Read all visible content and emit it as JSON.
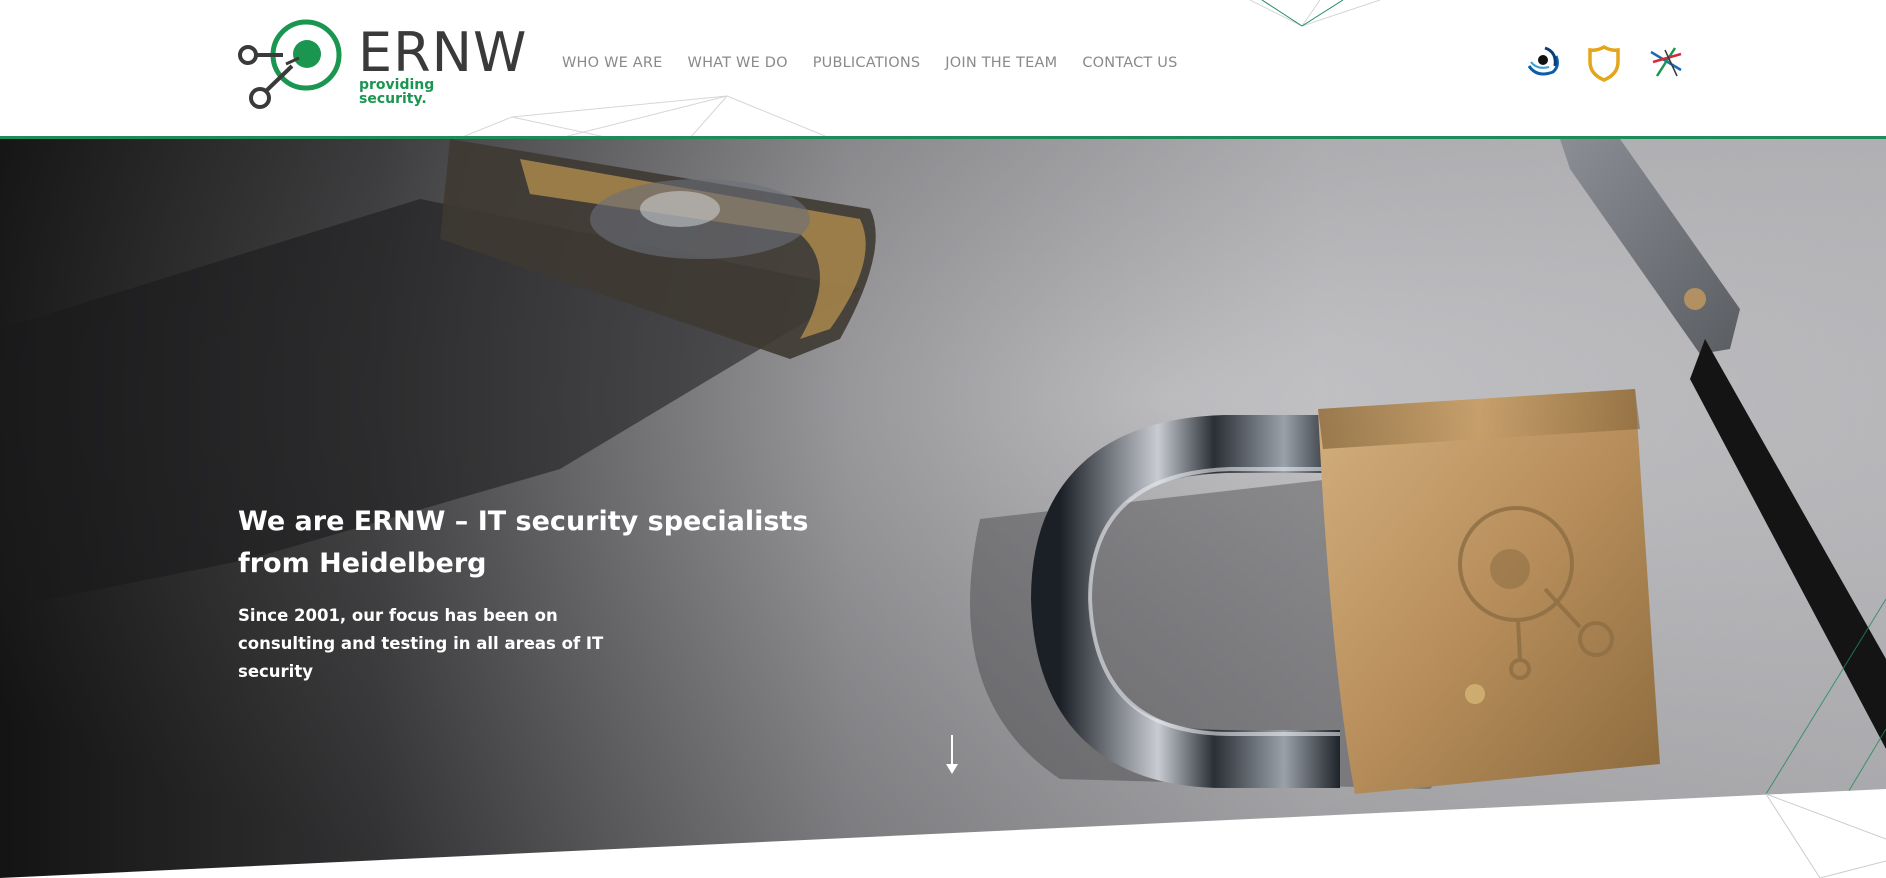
{
  "brand": {
    "name": "ERNW",
    "tagline": "providing security."
  },
  "nav": {
    "items": [
      {
        "label": "WHO WE ARE"
      },
      {
        "label": "WHAT WE DO"
      },
      {
        "label": "PUBLICATIONS"
      },
      {
        "label": "JOIN THE TEAM"
      },
      {
        "label": "CONTACT US"
      }
    ]
  },
  "partners": [
    {
      "icon": "eye-logo-icon"
    },
    {
      "icon": "shield-logo-icon"
    },
    {
      "icon": "troopers-logo-icon"
    }
  ],
  "hero": {
    "title": "We are ERNW – IT security specialists from Heidelberg",
    "subtitle": "Since 2001, our focus has been on consulting and testing in all areas of IT security",
    "scroll_icon": "arrow-down-icon"
  },
  "colors": {
    "accent": "#1a9650",
    "header_border": "#1f8a5a",
    "nav_text": "#8a8a8a",
    "logo_text": "#3a3a3a",
    "shield": "#e3a51a"
  }
}
